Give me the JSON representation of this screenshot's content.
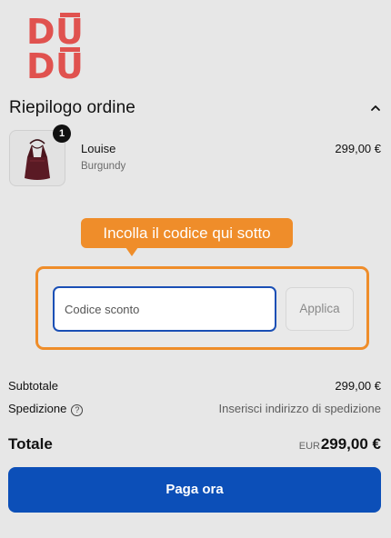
{
  "brand": {
    "logo_row1": "DŪ",
    "logo_row2": "DŪ",
    "color": "#e0524f"
  },
  "summary": {
    "title": "Riepilogo ordine",
    "toggle_icon": "chevron-up-icon"
  },
  "product": {
    "name": "Louise",
    "variant": "Burgundy",
    "price": "299,00 €",
    "quantity": "1",
    "image_icon": "burgundy-tote-bag"
  },
  "tooltip": {
    "text": "Incolla il codice qui sotto",
    "color": "#ef8d2a"
  },
  "discount": {
    "placeholder": "Codice sconto",
    "value": "",
    "apply_label": "Applica"
  },
  "totals": {
    "subtotal_label": "Subtotale",
    "subtotal_value": "299,00 €",
    "shipping_label": "Spedizione",
    "shipping_help_icon": "question-circle-icon",
    "shipping_value": "Inserisci indirizzo di spedizione",
    "total_label": "Totale",
    "currency": "EUR",
    "total_value": "299,00 €"
  },
  "actions": {
    "pay_label": "Paga ora",
    "accent": "#0c4fb8"
  }
}
